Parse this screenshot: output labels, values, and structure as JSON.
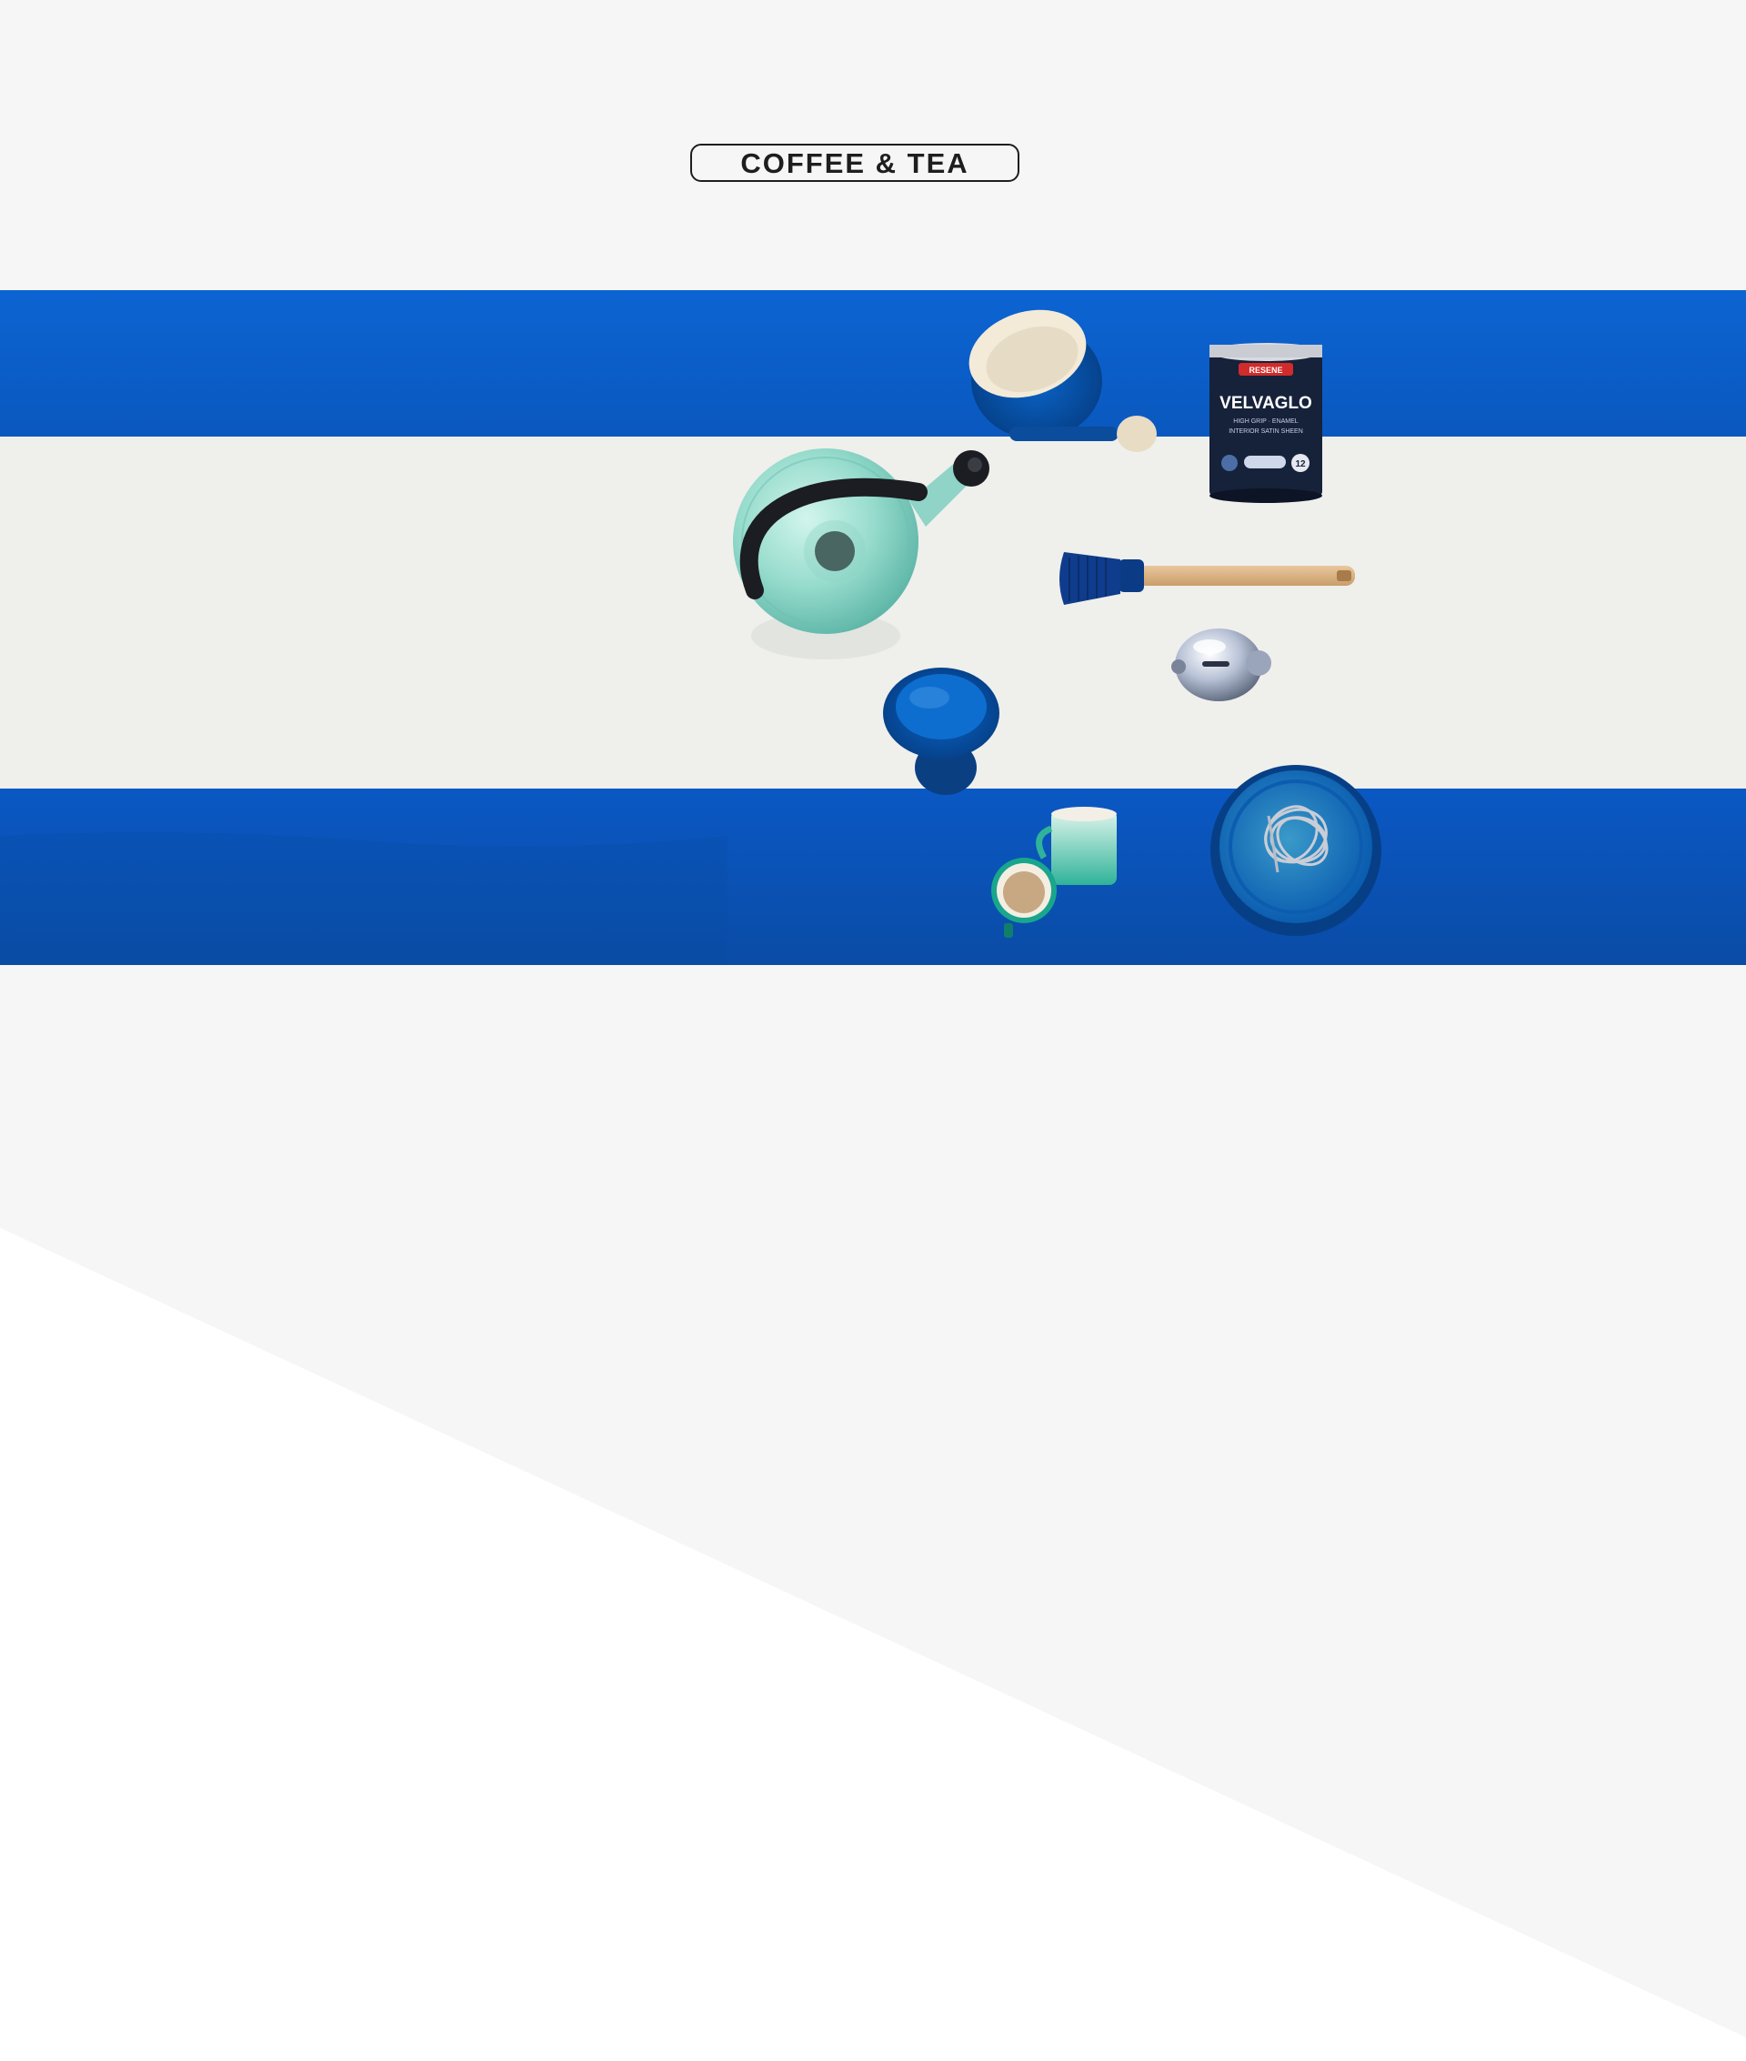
{
  "category": {
    "label": "COFFEE & TEA"
  },
  "hero": {
    "can_brand": "RESENE",
    "can_product": "VELVAGLO",
    "can_subtitle": "HIGH GRIP · ENAMEL",
    "can_finish": "INTERIOR SATIN SHEEN",
    "can_number": "12",
    "colors": {
      "stripe_blue": "#0b5ec9",
      "stripe_blue_dark": "#0a4fae",
      "table_white": "#efefec",
      "kettle_mint": "#9fe0d4",
      "handle_black": "#1b1d22",
      "bowl_blue": "#0a58b5",
      "can_navy": "#16213a"
    }
  },
  "page": {
    "background": "#f6f6f6",
    "panel_white": "#ffffff"
  }
}
